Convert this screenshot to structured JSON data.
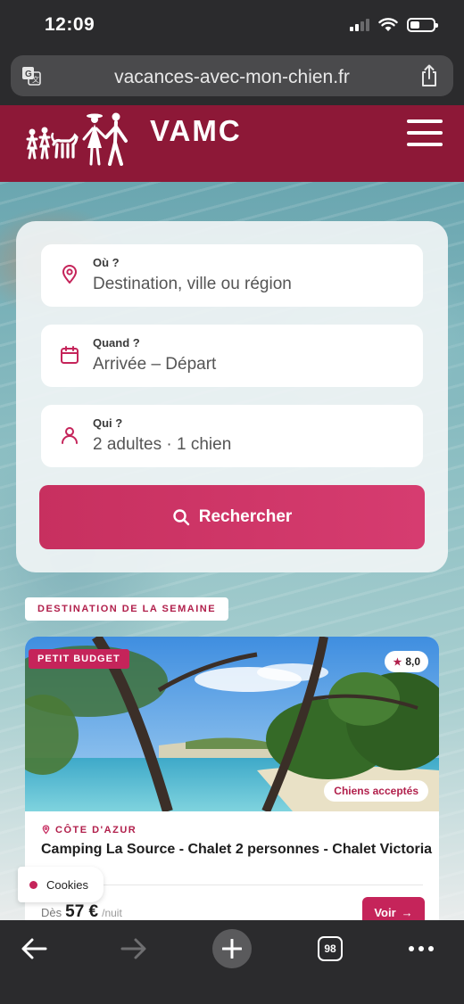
{
  "status_bar": {
    "time": "12:09"
  },
  "browser": {
    "url": "vacances-avec-mon-chien.fr",
    "tab_count": "98"
  },
  "site": {
    "logo_text": "VAMC"
  },
  "search": {
    "where": {
      "label": "Où ?",
      "placeholder": "Destination, ville ou région"
    },
    "when": {
      "label": "Quand ?",
      "placeholder": "Arrivée – Départ"
    },
    "who": {
      "label": "Qui ?",
      "value": "2 adultes · 1 chien"
    },
    "button_label": "Rechercher"
  },
  "destination_tag": "DESTINATION DE LA SEMAINE",
  "card": {
    "budget_badge": "PETIT BUDGET",
    "rating": "8,0",
    "dogs_badge": "Chiens acceptés",
    "region": "CÔTE D'AZUR",
    "title": "Camping La Source - Chalet 2 personnes - Chalet Victoria",
    "price_prefix": "Dès",
    "price": "57 €",
    "price_unit": "/nuit",
    "cta_label": "Voir"
  },
  "cookies_label": "Cookies",
  "colors": {
    "brand": "#8d1837",
    "accent": "#c5245a"
  }
}
